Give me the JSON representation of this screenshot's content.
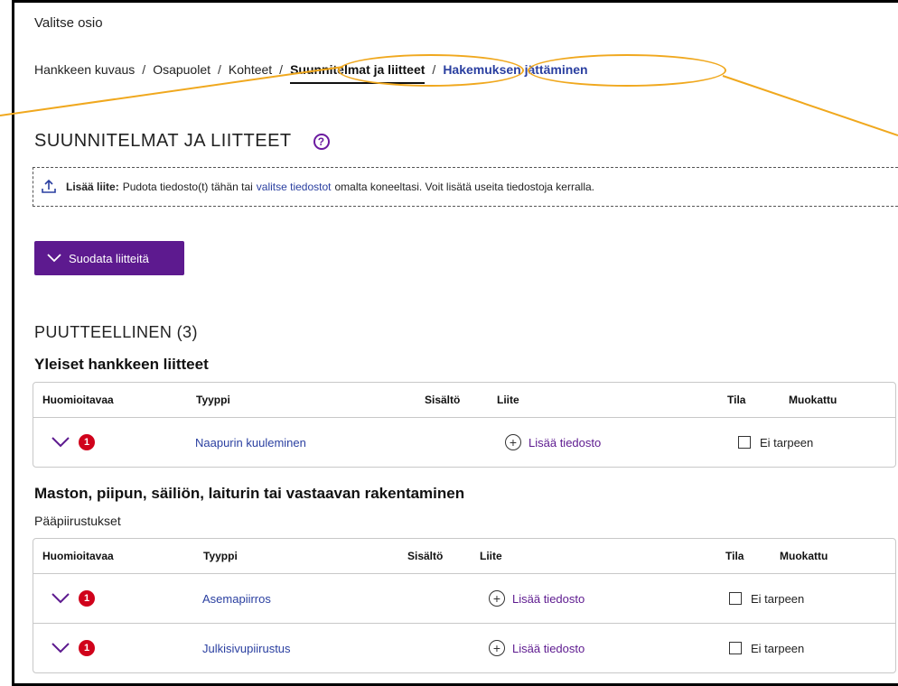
{
  "section_label": "Valitse osio",
  "breadcrumb": [
    {
      "label": "Hankkeen kuvaus"
    },
    {
      "label": "Osapuolet"
    },
    {
      "label": "Kohteet"
    },
    {
      "label": "Suunnitelmat ja liitteet"
    },
    {
      "label": "Hakemuksen jättäminen"
    }
  ],
  "breadcrumb_sep": "/",
  "page_title": "SUUNNITELMAT JA LIITTEET",
  "help_icon_glyph": "?",
  "dropzone": {
    "bold_label": "Lisää liite:",
    "text_before": "Pudota tiedosto(t) tähän tai",
    "link": "valitse tiedostot",
    "text_after": "omalta koneeltasi. Voit lisätä useita tiedostoja kerralla."
  },
  "filter_button": "Suodata liitteitä",
  "group_title": "PUUTTEELLINEN (3)",
  "columns": {
    "notice": "Huomioitavaa",
    "type": "Tyyppi",
    "content": "Sisältö",
    "attachment": "Liite",
    "status": "Tila",
    "modified": "Muokattu"
  },
  "categories": [
    {
      "title": "Yleiset hankkeen liitteet",
      "subtitle": "",
      "rows": [
        {
          "badge": "1",
          "type": "Naapurin kuuleminen",
          "add_file": "Lisää tiedosto",
          "status": "Ei tarpeen"
        }
      ]
    },
    {
      "title": "Maston, piipun, säiliön, laiturin tai vastaavan rakentaminen",
      "subtitle": "Pääpiirustukset",
      "rows": [
        {
          "badge": "1",
          "type": "Asemapiirros",
          "add_file": "Lisää tiedosto",
          "status": "Ei tarpeen"
        },
        {
          "badge": "1",
          "type": "Julkisivupiirustus",
          "add_file": "Lisää tiedosto",
          "status": "Ei tarpeen"
        }
      ]
    }
  ],
  "colors": {
    "accent_purple": "#5d1a8f",
    "link_blue": "#2a3fa0",
    "badge_red": "#d0021b",
    "annotation_orange": "#f0a81e"
  },
  "icons": {
    "upload": "upload-icon",
    "help": "help-icon",
    "chevron": "chevron-down-icon",
    "plus": "plus-circle-icon"
  }
}
